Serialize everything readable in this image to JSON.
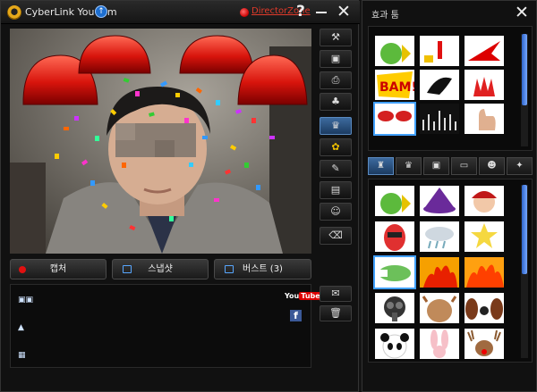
{
  "app": {
    "title": "CyberLink YouCam",
    "director_zone": "DirectorZone",
    "help": "?",
    "close": "✕"
  },
  "capture": {
    "capture_label": "캡처",
    "snapshot_label": "스냅샷",
    "burst_label": "버스트 (3)"
  },
  "gallery": {
    "youtube": "YouTube",
    "facebook": "f"
  },
  "effects": {
    "title": "효과 툼",
    "tabs": [
      "scene-icon",
      "avatar-icon",
      "frame-icon",
      "particle-icon",
      "face-icon",
      "magic-icon"
    ]
  },
  "colors": {
    "accent": "#41a0ff",
    "record": "#e01010",
    "director_zone": "#e03a2a"
  }
}
